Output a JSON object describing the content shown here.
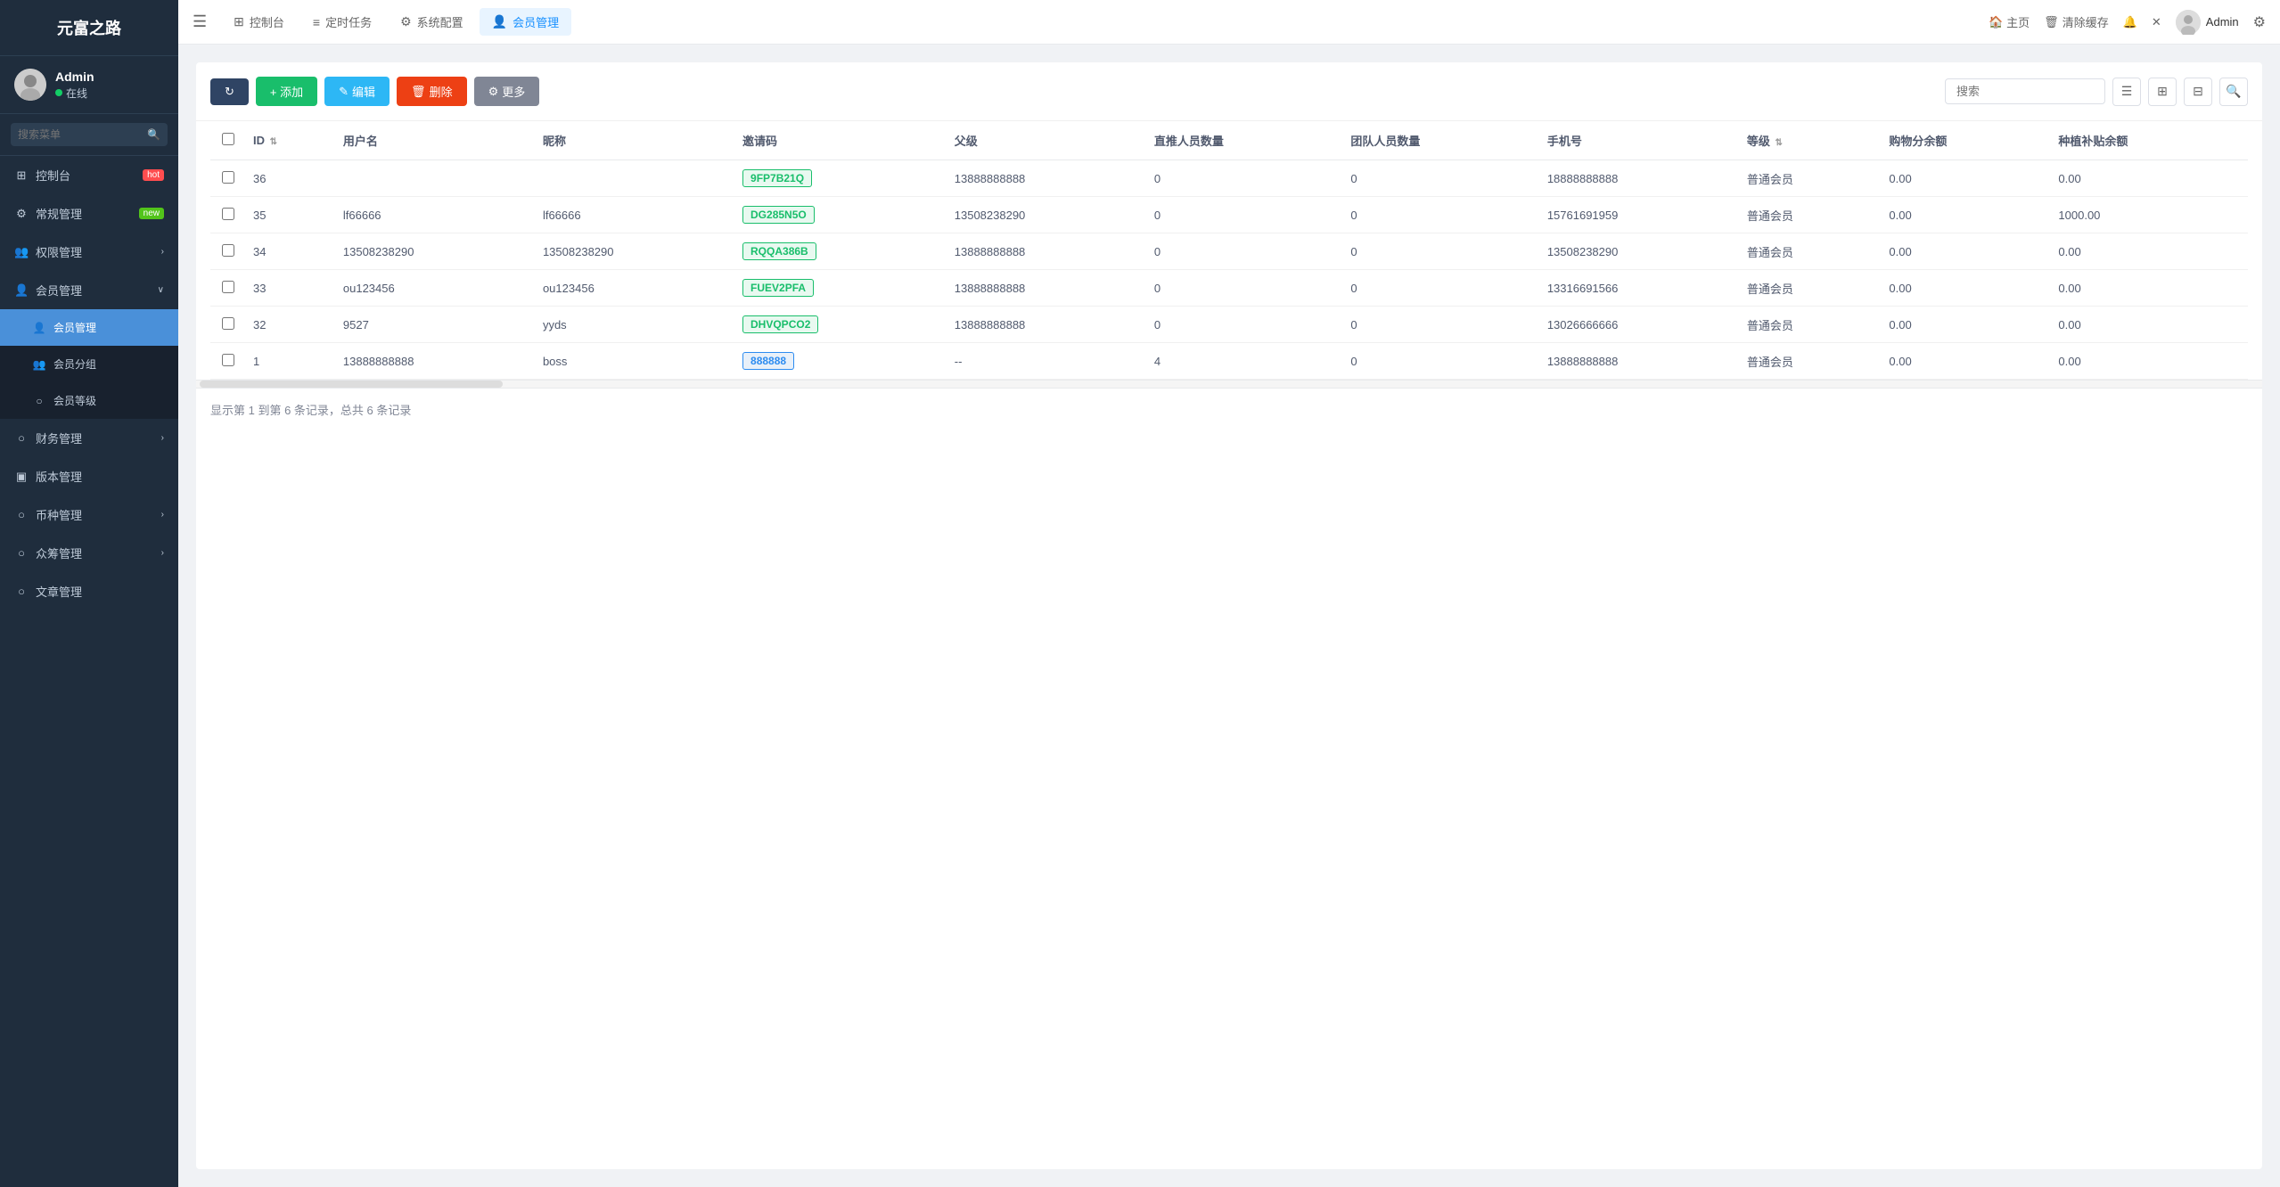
{
  "app": {
    "title": "元富之路",
    "user": {
      "name": "Admin",
      "status": "在线"
    },
    "search_placeholder": "搜索菜单"
  },
  "sidebar": {
    "items": [
      {
        "id": "dashboard",
        "label": "控制台",
        "icon": "⊞",
        "badge": "hot",
        "badge_text": "hot",
        "has_arrow": false
      },
      {
        "id": "general",
        "label": "常规管理",
        "icon": "⚙",
        "badge": "new",
        "badge_text": "new",
        "has_arrow": false
      },
      {
        "id": "permission",
        "label": "权限管理",
        "icon": "👥",
        "has_arrow": true
      },
      {
        "id": "member",
        "label": "会员管理",
        "icon": "👤",
        "has_arrow": true,
        "expanded": true
      }
    ],
    "member_sub": [
      {
        "id": "member-manage",
        "label": "会员管理",
        "active": true
      },
      {
        "id": "member-group",
        "label": "会员分组",
        "active": false
      },
      {
        "id": "member-level",
        "label": "会员等级",
        "active": false
      }
    ],
    "other_items": [
      {
        "id": "finance",
        "label": "财务管理",
        "icon": "○",
        "has_arrow": true
      },
      {
        "id": "version",
        "label": "版本管理",
        "icon": "▣",
        "has_arrow": false
      },
      {
        "id": "currency",
        "label": "币种管理",
        "icon": "○",
        "has_arrow": true
      },
      {
        "id": "crowdfunding",
        "label": "众筹管理",
        "icon": "○",
        "has_arrow": true
      },
      {
        "id": "article",
        "label": "文章管理",
        "icon": "○",
        "has_arrow": false
      }
    ]
  },
  "topnav": {
    "tabs": [
      {
        "id": "dashboard-tab",
        "label": "控制台",
        "icon": "⊞"
      },
      {
        "id": "schedule-tab",
        "label": "定时任务",
        "icon": "≡"
      },
      {
        "id": "sysconfig-tab",
        "label": "系统配置",
        "icon": "⚙"
      },
      {
        "id": "member-tab",
        "label": "会员管理",
        "icon": "👤",
        "active": true
      }
    ],
    "right": {
      "home": "主页",
      "clear_cache": "清除缓存",
      "admin": "Admin"
    },
    "search_placeholder": "搜索"
  },
  "toolbar": {
    "refresh_label": "",
    "add_label": "+ 添加",
    "edit_label": "✎ 编辑",
    "delete_label": "🗑 删除",
    "more_label": "⚙ 更多",
    "search_placeholder": "搜索"
  },
  "table": {
    "columns": [
      {
        "id": "id",
        "label": "ID",
        "sortable": true
      },
      {
        "id": "username",
        "label": "用户名"
      },
      {
        "id": "nickname",
        "label": "昵称"
      },
      {
        "id": "invite_code",
        "label": "邀请码"
      },
      {
        "id": "parent",
        "label": "父级"
      },
      {
        "id": "direct_count",
        "label": "直推人员数量"
      },
      {
        "id": "team_count",
        "label": "团队人员数量"
      },
      {
        "id": "phone",
        "label": "手机号"
      },
      {
        "id": "level",
        "label": "等级",
        "sortable": true
      },
      {
        "id": "shopping_balance",
        "label": "购物分余额"
      },
      {
        "id": "planting_balance",
        "label": "种植补贴余额"
      }
    ],
    "rows": [
      {
        "id": 36,
        "username": "",
        "nickname": "",
        "invite_code": "9FP7B21Q",
        "invite_style": "green",
        "parent": "13888888888",
        "direct_count": 0,
        "team_count": 0,
        "phone": "18888888888",
        "level": "普通会员",
        "shopping_balance": "0.00",
        "planting_balance": "0.00"
      },
      {
        "id": 35,
        "username": "lf66666",
        "nickname": "lf66666",
        "invite_code": "DG285N5O",
        "invite_style": "green",
        "parent": "13508238290",
        "direct_count": 0,
        "team_count": 0,
        "phone": "15761691959",
        "level": "普通会员",
        "shopping_balance": "0.00",
        "planting_balance": "1000.00"
      },
      {
        "id": 34,
        "username": "13508238290",
        "nickname": "13508238290",
        "invite_code": "RQQA386B",
        "invite_style": "green",
        "parent": "13888888888",
        "direct_count": 0,
        "team_count": 0,
        "phone": "13508238290",
        "level": "普通会员",
        "shopping_balance": "0.00",
        "planting_balance": "0.00"
      },
      {
        "id": 33,
        "username": "ou123456",
        "nickname": "ou123456",
        "invite_code": "FUEV2PFA",
        "invite_style": "green",
        "parent": "13888888888",
        "direct_count": 0,
        "team_count": 0,
        "phone": "13316691566",
        "level": "普通会员",
        "shopping_balance": "0.00",
        "planting_balance": "0.00"
      },
      {
        "id": 32,
        "username": "9527",
        "nickname": "yyds",
        "invite_code": "DHVQPCO2",
        "invite_style": "green",
        "parent": "13888888888",
        "direct_count": 0,
        "team_count": 0,
        "phone": "13026666666",
        "level": "普通会员",
        "shopping_balance": "0.00",
        "planting_balance": "0.00"
      },
      {
        "id": 1,
        "username": "13888888888",
        "nickname": "boss",
        "invite_code": "888888",
        "invite_style": "special",
        "parent": "--",
        "direct_count": 4,
        "team_count": 0,
        "phone": "13888888888",
        "level": "普通会员",
        "shopping_balance": "0.00",
        "planting_balance": "0.00"
      }
    ],
    "footer": "显示第 1 到第 6 条记录，总共 6 条记录"
  }
}
